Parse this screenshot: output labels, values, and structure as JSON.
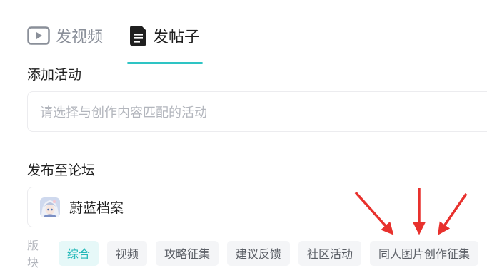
{
  "tabs": [
    {
      "label": "发视频",
      "icon": "play-icon",
      "selected": false
    },
    {
      "label": "发帖子",
      "icon": "document-icon",
      "selected": true
    }
  ],
  "activity": {
    "label": "添加活动",
    "placeholder": "请选择与创作内容匹配的活动"
  },
  "forum": {
    "label": "发布至论坛",
    "avatar_icon": "forum-avatar-image",
    "name": "蔚蓝档案"
  },
  "boards": {
    "label": "版块",
    "items": [
      "综合",
      "视频",
      "攻略征集",
      "建议反馈",
      "社区活动",
      "同人图片创作征集"
    ],
    "selected": "综合"
  },
  "colors": {
    "accent": "#2ec4c4",
    "annotation_arrow": "#e8312d"
  }
}
